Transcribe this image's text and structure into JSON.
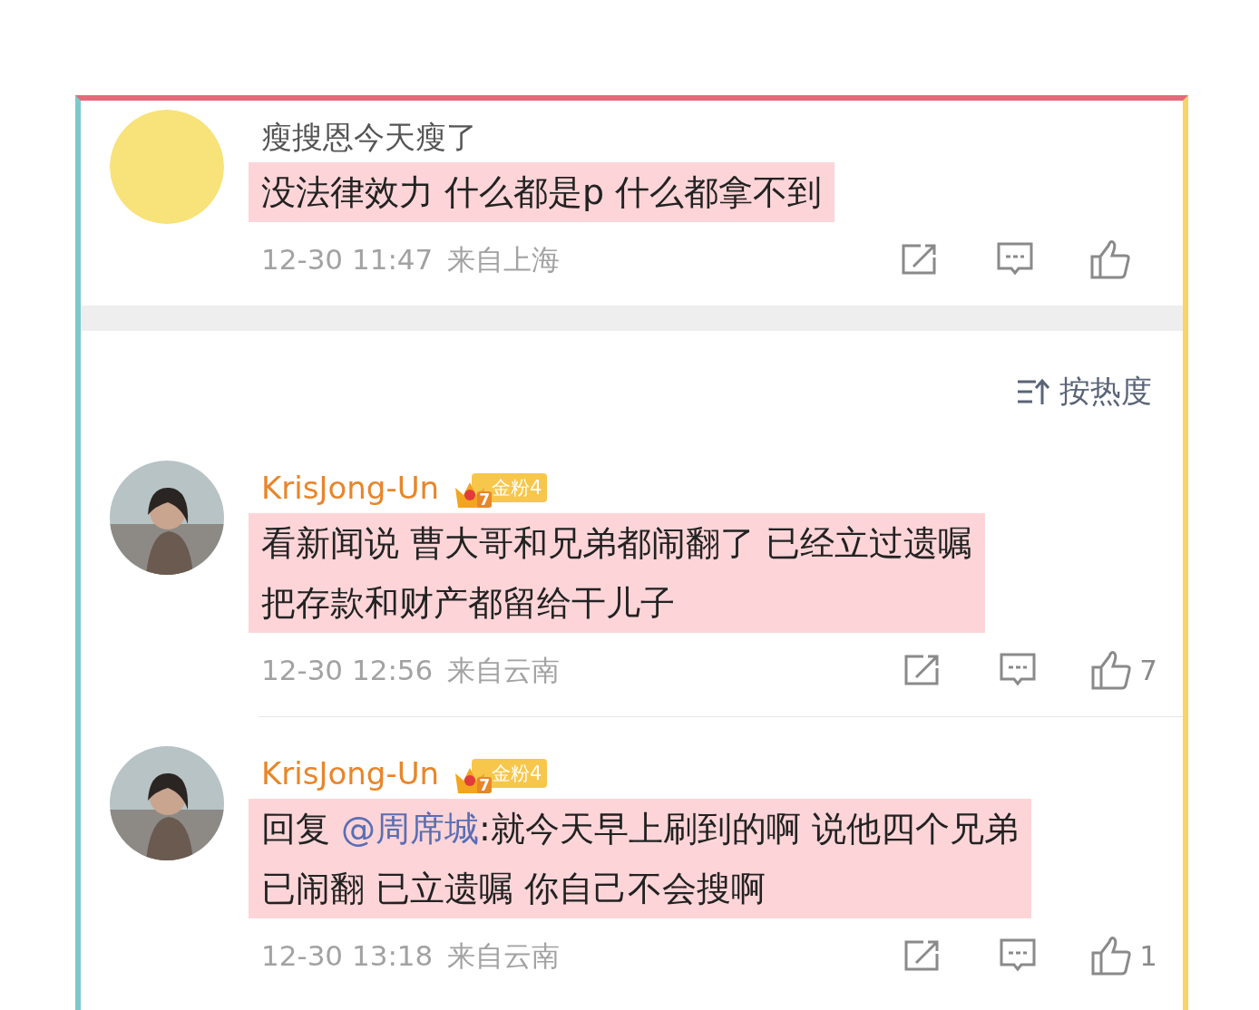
{
  "comments": [
    {
      "author": "瘦搜恩今天瘦了",
      "highlighted": true,
      "lines": [
        [
          {
            "kind": "text",
            "text": "没法律效力 什么都是p 什么都拿不到"
          }
        ]
      ],
      "time": "12-30 11:47",
      "source": "来自上海"
    },
    {
      "author": "KrisJong-Un",
      "badge": {
        "crown_level": "7",
        "label": "金粉4"
      },
      "highlighted": true,
      "lines": [
        [
          {
            "kind": "text",
            "text": "看新闻说 曹大哥和兄弟都闹翻了 已经立过遗嘱"
          }
        ],
        [
          {
            "kind": "text",
            "text": "把存款和财产都留给干儿子"
          }
        ]
      ],
      "time": "12-30 12:56",
      "source": "来自云南",
      "likes": "7"
    },
    {
      "author": "KrisJong-Un",
      "badge": {
        "crown_level": "7",
        "label": "金粉4"
      },
      "highlighted": true,
      "lines": [
        [
          {
            "kind": "text",
            "text": "回复 "
          },
          {
            "kind": "mention",
            "text": "@周席城"
          },
          {
            "kind": "text",
            "text": ":就今天早上刷到的啊 说他四个兄弟"
          }
        ],
        [
          {
            "kind": "text",
            "text": "已闹翻 已立遗嘱 你自己不会搜啊"
          }
        ]
      ],
      "time": "12-30 13:18",
      "source": "来自云南",
      "likes": "1"
    }
  ],
  "sort": {
    "label": "按热度"
  }
}
